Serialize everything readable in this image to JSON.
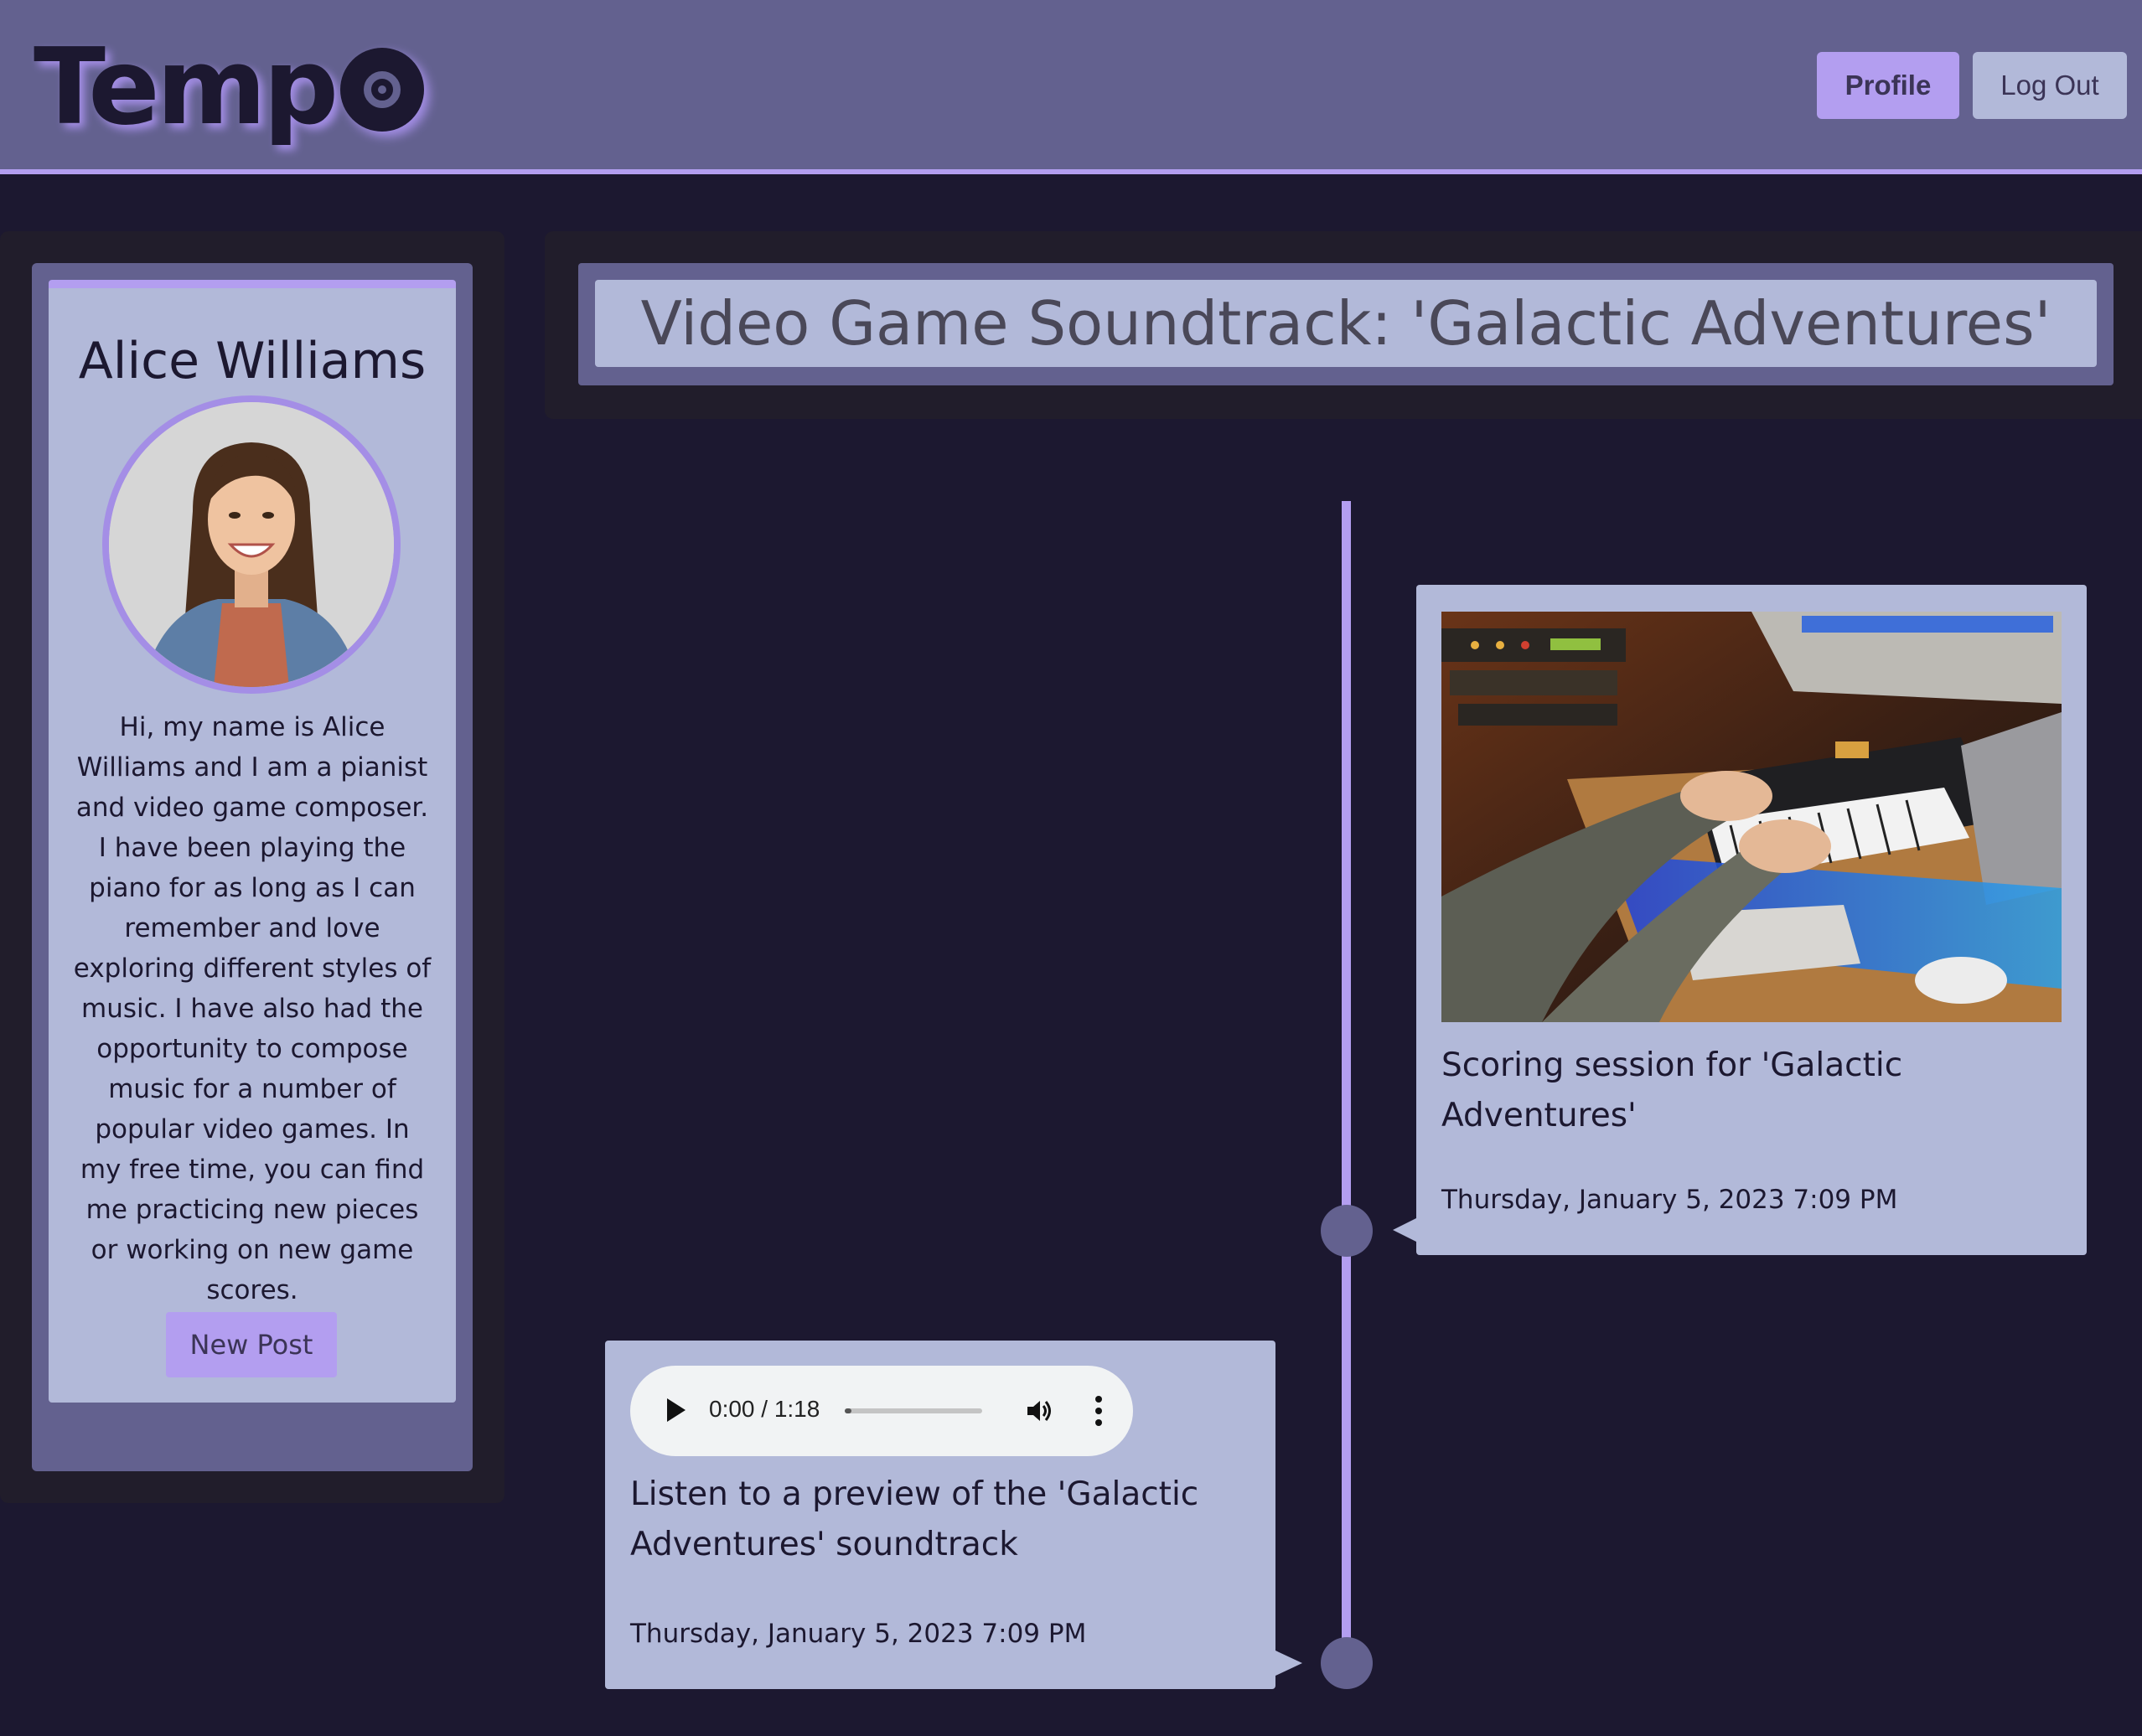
{
  "header": {
    "logo_text": "Temp",
    "profile_label": "Profile",
    "logout_label": "Log Out"
  },
  "sidebar": {
    "name": "Alice Williams",
    "bio": "Hi, my name is Alice Williams and I am a pianist and video game composer. I have been playing the piano for as long as I can remember and love exploring different styles of music. I have also had the opportunity to compose music for a number of popular video games. In my free time, you can find me practicing new pieces or working on new game scores.",
    "new_post_label": "New Post"
  },
  "page": {
    "title": "Video Game Soundtrack: 'Galactic Adventures'"
  },
  "posts": [
    {
      "type": "image",
      "caption": "Scoring session for 'Galactic Adventures'",
      "date": "Thursday, January 5, 2023 7:09 PM"
    },
    {
      "type": "audio",
      "audio_time": "0:00 / 1:18",
      "audio_progress": 0.05,
      "caption": "Listen to a preview of the 'Galactic Adventures' soundtrack",
      "date": "Thursday, January 5, 2023 7:09 PM"
    }
  ],
  "colors": {
    "background": "#1c1830",
    "header": "#63618f",
    "accent": "#b39ef0",
    "card": "#b2b9d9"
  }
}
